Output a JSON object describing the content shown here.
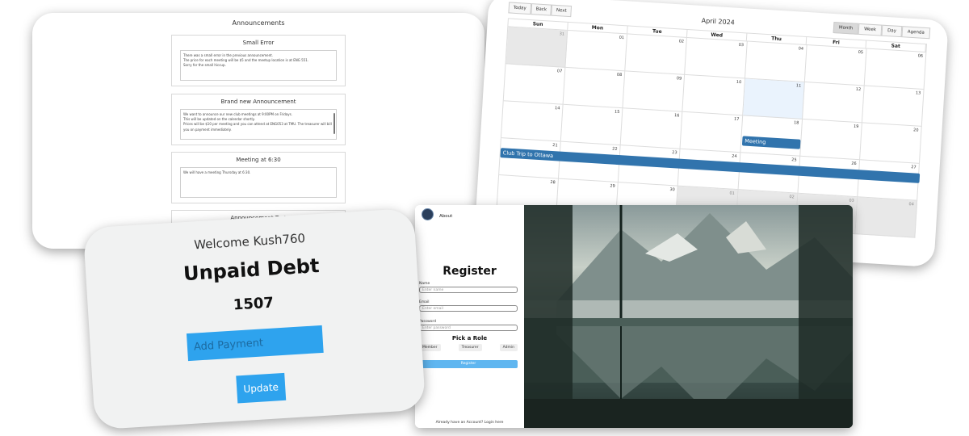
{
  "announcements": {
    "title": "Announcements",
    "items": [
      {
        "title": "Small Error",
        "lines": [
          "There was a small error in the previous announcement.",
          "The price for each meeting will be $5 and the meetup location is at ENG 551.",
          "Sorry for the small hiccup."
        ]
      },
      {
        "title": "Brand new Announcement",
        "lines": [
          "We want to announce our new club meetings at 9:00PM on Fridays.",
          "This will be updated on the calendar shortly.",
          "Prices will be $10 per meeting and you can attend at ENG053 at TMU. The treasurer will bill you on payment immediately."
        ]
      },
      {
        "title": "Meeting at 6:30",
        "lines": [
          "We will have a meeting Thursday at 6:30."
        ]
      },
      {
        "title": "Announcement Test",
        "lines": []
      }
    ]
  },
  "calendar": {
    "title": "April 2024",
    "nav_buttons": [
      "Today",
      "Back",
      "Next"
    ],
    "view_buttons": [
      "Month",
      "Week",
      "Day",
      "Agenda"
    ],
    "active_view": "Month",
    "days_of_week": [
      "Sun",
      "Mon",
      "Tue",
      "Wed",
      "Thu",
      "Fri",
      "Sat"
    ],
    "weeks": [
      [
        "31",
        "01",
        "02",
        "03",
        "04",
        "05",
        "06"
      ],
      [
        "07",
        "08",
        "09",
        "10",
        "11",
        "12",
        "13"
      ],
      [
        "14",
        "15",
        "16",
        "17",
        "18",
        "19",
        "20"
      ],
      [
        "21",
        "22",
        "23",
        "24",
        "25",
        "26",
        "27"
      ],
      [
        "28",
        "29",
        "30",
        "01",
        "02",
        "03",
        "04"
      ]
    ],
    "events": [
      {
        "title": "Meeting",
        "date": "18"
      },
      {
        "title": "Club Trip to Ottawa",
        "date": "21-27"
      }
    ],
    "event_color": "#3174ad"
  },
  "debt": {
    "welcome": "Welcome Kush760",
    "heading": "Unpaid Debt",
    "amount": "1507",
    "payment_placeholder": "Add Payment",
    "update_label": "Update",
    "accent": "#2ea3ee"
  },
  "register": {
    "about": "About",
    "title": "Register",
    "name_label": "Name",
    "name_placeholder": "Enter name",
    "email_label": "Email",
    "email_placeholder": "Enter email",
    "password_label": "Password",
    "password_placeholder": "Enter password",
    "role_heading": "Pick a Role",
    "roles": [
      "Member",
      "Treasurer",
      "Admin"
    ],
    "register_button": "Register",
    "footer": "Already have an Account? Login here"
  }
}
